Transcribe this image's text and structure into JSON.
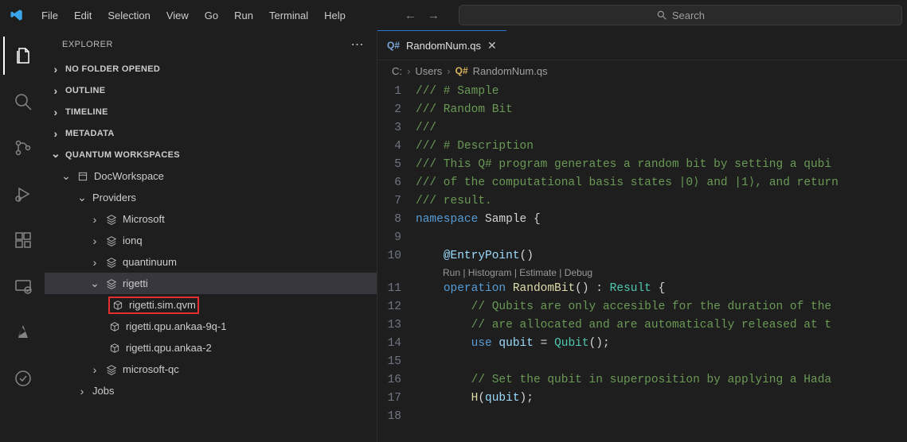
{
  "menu": {
    "file": "File",
    "edit": "Edit",
    "selection": "Selection",
    "view": "View",
    "go": "Go",
    "run": "Run",
    "terminal": "Terminal",
    "help": "Help"
  },
  "search_placeholder": "Search",
  "sidebar": {
    "title": "EXPLORER",
    "sections": {
      "no_folder": "NO FOLDER OPENED",
      "outline": "OUTLINE",
      "timeline": "TIMELINE",
      "metadata": "METADATA",
      "quantum": "QUANTUM WORKSPACES"
    },
    "workspace": "DocWorkspace",
    "providers_label": "Providers",
    "providers": {
      "microsoft": "Microsoft",
      "ionq": "ionq",
      "quantinuum": "quantinuum",
      "rigetti": "rigetti",
      "microsoft_qc": "microsoft-qc"
    },
    "rigetti_targets": {
      "sim_qvm": "rigetti.sim.qvm",
      "qpu_ankaa_9q_1": "rigetti.qpu.ankaa-9q-1",
      "qpu_ankaa_2": "rigetti.qpu.ankaa-2"
    },
    "jobs": "Jobs"
  },
  "tab": {
    "prefix": "Q#",
    "file": "RandomNum.qs"
  },
  "breadcrumb": {
    "c": "C:",
    "users": "Users",
    "badge": "Q#",
    "file": "RandomNum.qs"
  },
  "codelens": "Run | Histogram | Estimate | Debug",
  "code": {
    "l1": "/// # Sample",
    "l2": "/// Random Bit",
    "l3": "///",
    "l4": "/// # Description",
    "l5": "/// This Q# program generates a random bit by setting a qubi",
    "l6": "/// of the computational basis states |0⟩ and |1⟩, and return",
    "l7": "/// result.",
    "l8_kw": "namespace",
    "l8_name": " Sample ",
    "l8_brace": "{",
    "l10_attr": "@EntryPoint",
    "l10_paren": "()",
    "l11_kw": "operation",
    "l11_name": " RandomBit",
    "l11_paren": "() : ",
    "l11_type": "Result",
    "l11_brace": " {",
    "l12": "// Qubits are only accesible for the duration of the",
    "l13": "// are allocated and are automatically released at t",
    "l14_use": "use",
    "l14_var": " qubit ",
    "l14_eq": "= ",
    "l14_call": "Qubit",
    "l14_paren": "();",
    "l16": "// Set the qubit in superposition by applying a Hada",
    "l17_fn": "H",
    "l17_open": "(",
    "l17_arg": "qubit",
    "l17_close": ");"
  },
  "line_numbers": [
    "1",
    "2",
    "3",
    "4",
    "5",
    "6",
    "7",
    "8",
    "9",
    "10",
    "11",
    "12",
    "13",
    "14",
    "15",
    "16",
    "17",
    "18"
  ]
}
